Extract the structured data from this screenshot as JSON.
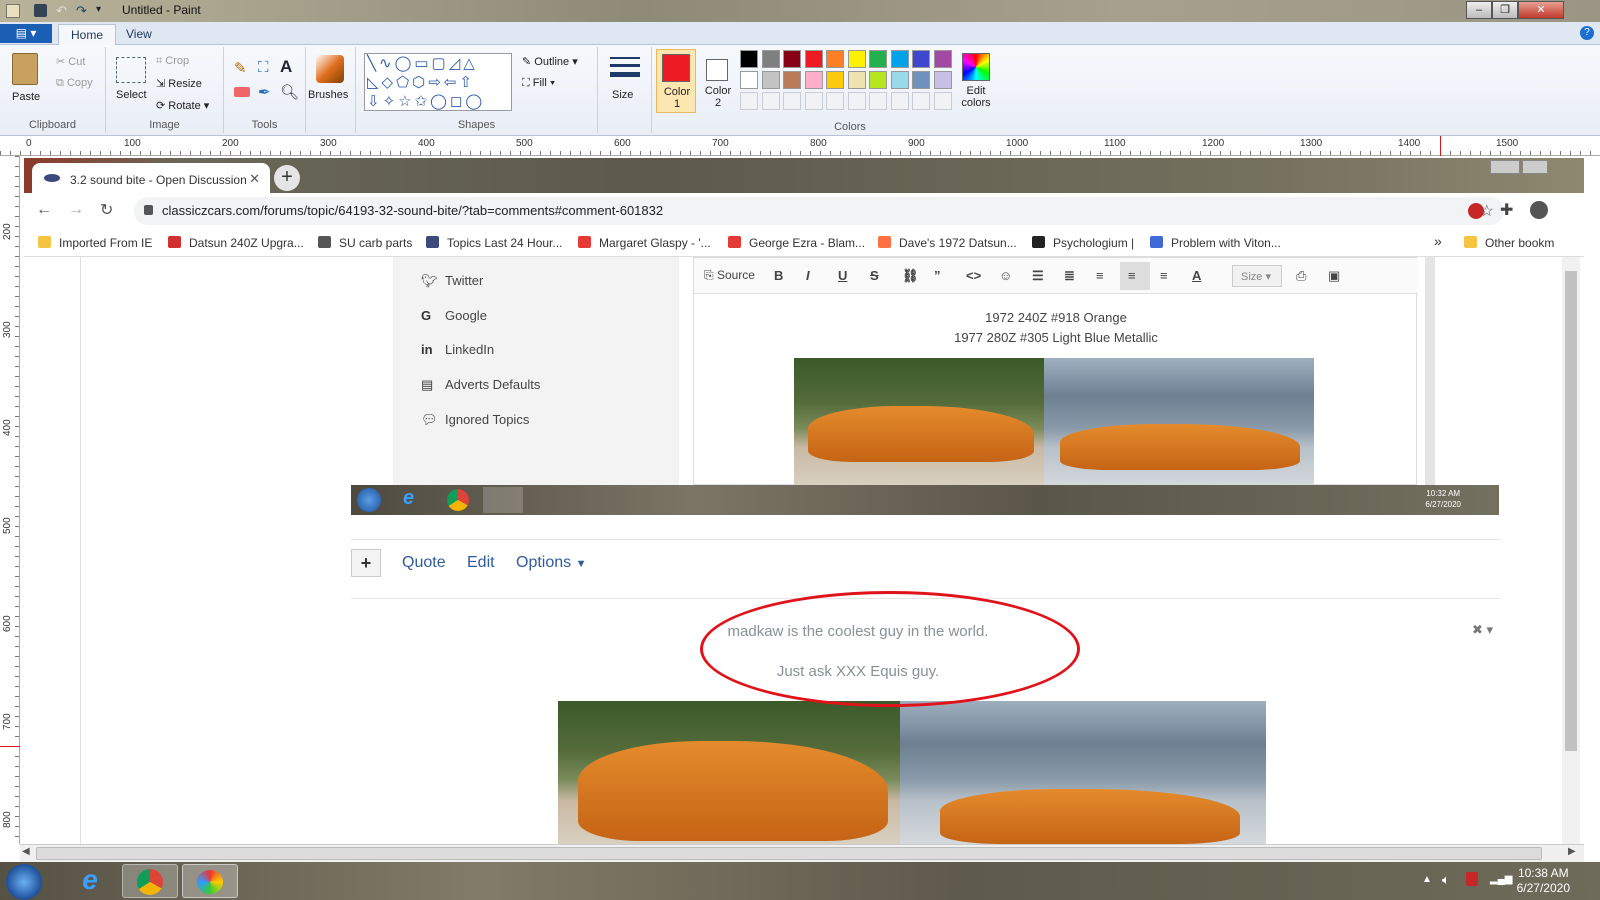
{
  "paint": {
    "title": "Untitled - Paint",
    "tabs": [
      "Home",
      "View"
    ],
    "clipboard": {
      "paste": "Paste",
      "cut": "Cut",
      "copy": "Copy",
      "label": "Clipboard"
    },
    "image": {
      "select": "Select",
      "crop": "Crop",
      "resize": "Resize",
      "rotate": "Rotate",
      "label": "Image"
    },
    "tools": {
      "label": "Tools"
    },
    "brushes": "Brushes",
    "shapes": {
      "outline": "Outline",
      "fill": "Fill",
      "label": "Shapes"
    },
    "size": "Size",
    "color1": "Color\n1",
    "color2": "Color\n2",
    "colors_label": "Colors",
    "edit_colors": "Edit\ncolors",
    "palette": [
      "#000000",
      "#7f7f7f",
      "#880015",
      "#ed1c24",
      "#ff7f27",
      "#fff200",
      "#22b14c",
      "#00a2e8",
      "#3f48cc",
      "#a349a4",
      "#ffffff",
      "#c3c3c3",
      "#b97a57",
      "#ffaec9",
      "#ffc90e",
      "#efe4b0",
      "#b5e61d",
      "#99d9ea",
      "#7092be",
      "#c8bfe7"
    ],
    "color1_value": "#ed1c24",
    "ruler_h": [
      "0",
      "100",
      "200",
      "300",
      "400",
      "500",
      "600",
      "700",
      "800",
      "900",
      "1000",
      "1100",
      "1200",
      "1300",
      "1400",
      "1500"
    ],
    "ruler_v": [
      "200",
      "300",
      "400",
      "500",
      "600",
      "700",
      "800"
    ]
  },
  "browser": {
    "tab_title": "3.2 sound bite - Open Discussion",
    "url": "classiczcars.com/forums/topic/64193-32-sound-bite/?tab=comments#comment-601832",
    "bookmarks": [
      "Imported From IE",
      "Datsun 240Z Upgra...",
      "SU carb parts",
      "Topics Last 24 Hour...",
      "Margaret Glaspy - '...",
      "George Ezra - Blam...",
      "Dave's 1972 Datsun...",
      "Psychologium |",
      "Problem with Viton..."
    ],
    "more_bookmarks": "»",
    "other_bookmarks": "Other bookm"
  },
  "page": {
    "side_menu": [
      "Twitter",
      "Google",
      "LinkedIn",
      "Adverts Defaults",
      "Ignored Topics"
    ],
    "editor": {
      "source": "Source",
      "size": "Size",
      "caption1": "1972 240Z #918 Orange",
      "caption2": "1977 280Z #305 Light Blue Metallic"
    },
    "inner_clock": {
      "time": "10:32 AM",
      "date": "6/27/2020"
    },
    "actions": {
      "plus": "+",
      "quote": "Quote",
      "edit": "Edit",
      "options": "Options"
    },
    "post_line1": "madkaw is the coolest guy in the world.",
    "post_line2": "Just ask XXX Equis guy."
  },
  "taskbar": {
    "time": "10:38 AM",
    "date": "6/27/2020"
  }
}
